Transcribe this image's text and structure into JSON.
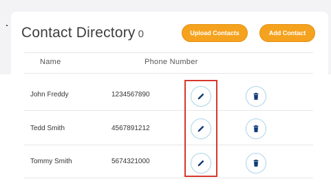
{
  "title": "Contact Directory",
  "count": "0",
  "buttons": {
    "upload": "Upload Contacts",
    "add": "Add Contact"
  },
  "columns": {
    "name": "Name",
    "phone": "Phone Number"
  },
  "rows": [
    {
      "name": "John Freddy",
      "phone": "1234567890"
    },
    {
      "name": "Tedd Smith",
      "phone": "4567891212"
    },
    {
      "name": "Tommy Smith",
      "phone": "5674321000"
    }
  ],
  "icons": {
    "edit": "pencil-icon",
    "delete": "trash-icon"
  },
  "colors": {
    "accent": "#f5a21f",
    "icon": "#123a7a",
    "highlight": "#d5362b",
    "iconBorder": "#a9d3e8"
  }
}
